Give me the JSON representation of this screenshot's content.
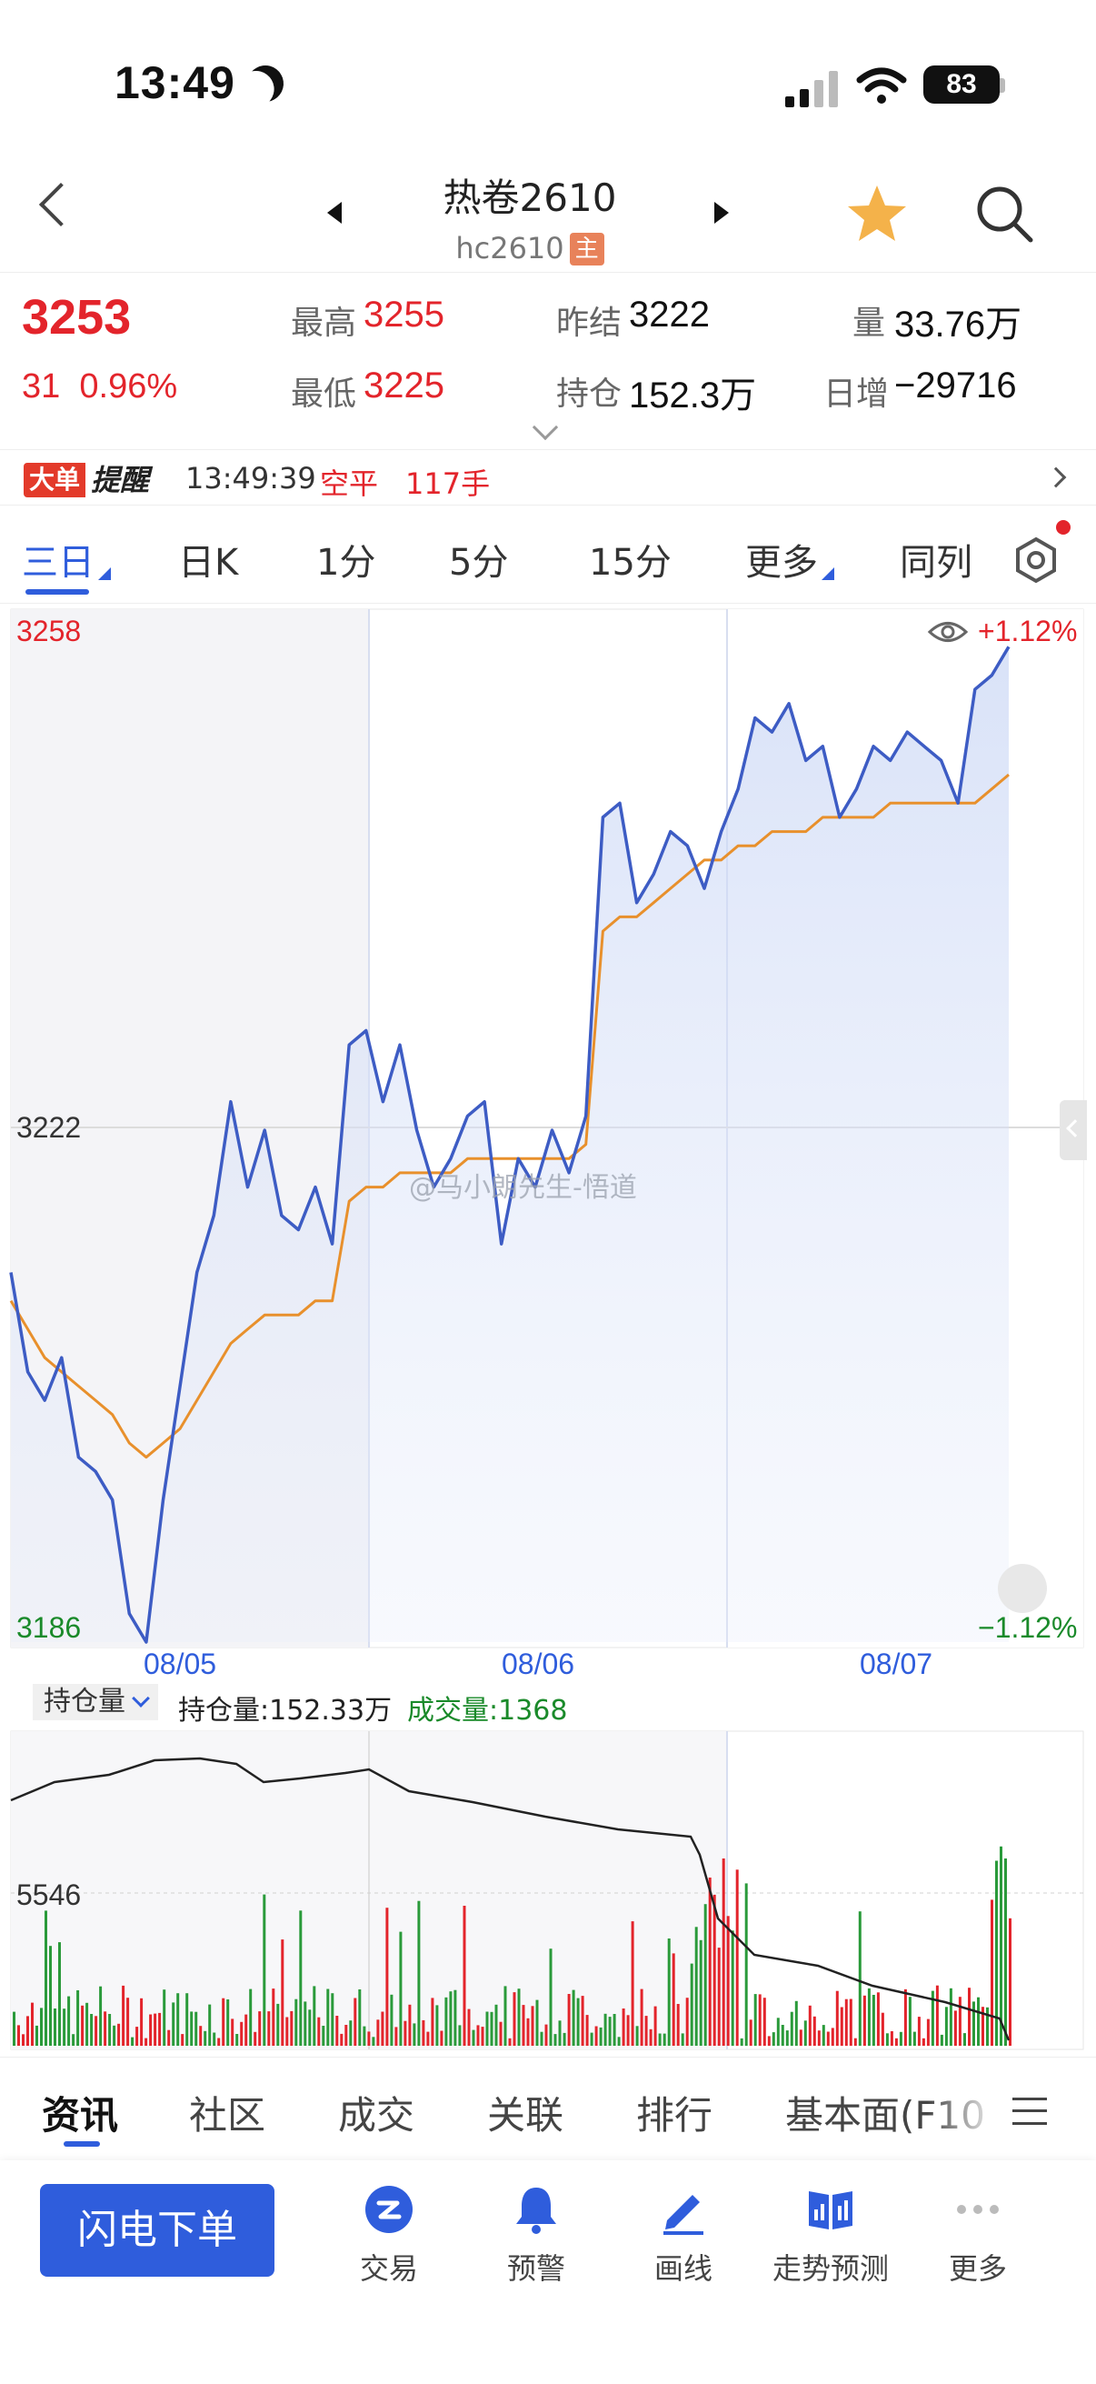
{
  "status": {
    "time": "13:49",
    "battery": "83"
  },
  "header": {
    "title": "热卷2610",
    "code": "hc2610",
    "badge": "主"
  },
  "quote": {
    "price": "3253",
    "change": "31",
    "change_pct": "0.96%",
    "high_label": "最高",
    "high": "3255",
    "low_label": "最低",
    "low": "3225",
    "prev_settle_label": "昨结",
    "prev_settle": "3222",
    "oi_label": "持仓",
    "oi": "152.3万",
    "vol_label": "量",
    "vol": "33.76万",
    "day_inc_label": "日增",
    "day_inc": "−29716"
  },
  "alert": {
    "badge_left": "大单",
    "badge_right": "提醒",
    "time": "13:49:39",
    "type": "空平",
    "qty": "117手"
  },
  "tabs": [
    "三日",
    "日K",
    "1分",
    "5分",
    "15分",
    "更多",
    "同列"
  ],
  "chart": {
    "top_price": "3258",
    "mid_price": "3222",
    "bottom_price": "3186",
    "top_pct": "+1.12%",
    "bottom_pct": "−1.12%",
    "dates": [
      "08/05",
      "08/06",
      "08/07"
    ],
    "watermark": "@马小朗先生-悟道",
    "colors": {
      "price_line": "#3d5cc4",
      "avg_line": "#e8902c",
      "up": "#e3242b",
      "down": "#2a9a3a"
    }
  },
  "chart_data": {
    "type": "line",
    "title": "",
    "xlabel": "",
    "ylabel": "",
    "ylim": [
      3186,
      3258
    ],
    "x_dates": [
      "08/05",
      "08/06",
      "08/07"
    ],
    "series": [
      {
        "values": [
          3212,
          3205,
          3203,
          3206,
          3199,
          3198,
          3196,
          3188,
          3186,
          3196,
          3204,
          3212,
          3216,
          3224,
          3218,
          3222,
          3216,
          3215,
          3218,
          3214,
          3228,
          3229,
          3224,
          3228,
          3222,
          3218,
          3220,
          3223,
          3224,
          3214,
          3220,
          3218,
          3222,
          3219,
          3223,
          3244,
          3245,
          3238,
          3240,
          3243,
          3242,
          3239,
          3243,
          3246,
          3251,
          3250,
          3252,
          3248,
          3249,
          3244,
          3246,
          3249,
          3248,
          3250,
          3249,
          3248,
          3245,
          3253,
          3254,
          3256
        ]
      },
      {
        "values": [
          3210,
          3208,
          3206,
          3205,
          3204,
          3203,
          3202,
          3200,
          3199,
          3200,
          3201,
          3203,
          3205,
          3207,
          3208,
          3209,
          3209,
          3209,
          3210,
          3210,
          3217,
          3218,
          3218,
          3219,
          3219,
          3219,
          3219,
          3220,
          3220,
          3220,
          3220,
          3220,
          3220,
          3220,
          3221,
          3236,
          3237,
          3237,
          3238,
          3239,
          3240,
          3241,
          3241,
          3242,
          3242,
          3243,
          3243,
          3243,
          3244,
          3244,
          3244,
          3244,
          3245,
          3245,
          3245,
          3245,
          3245,
          3245,
          3246,
          3247
        ]
      }
    ]
  },
  "volume": {
    "selector": "持仓量",
    "oi_text": "持仓量:152.33万",
    "vol_text": "成交量:1368",
    "axis_label": "5546"
  },
  "info_tabs": [
    "资讯",
    "社区",
    "成交",
    "关联",
    "排行",
    "基本面(F10"
  ],
  "bottom": {
    "flash_order": "闪电下单",
    "nav": [
      "交易",
      "预警",
      "画线",
      "走势预测",
      "更多"
    ]
  }
}
